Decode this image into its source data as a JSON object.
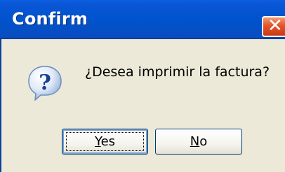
{
  "window": {
    "title": "Confirm",
    "close_glyph": "✕"
  },
  "dialog": {
    "icon": "question-icon",
    "message": "¿Desea imprimir la factura?"
  },
  "buttons": {
    "yes": {
      "mnemonic": "Y",
      "rest": "es"
    },
    "no": {
      "mnemonic": "N",
      "rest": "o"
    }
  },
  "colors": {
    "titlebar": "#0053cc",
    "dialog_bg": "#ece9d8",
    "close_button": "#e2552b"
  }
}
